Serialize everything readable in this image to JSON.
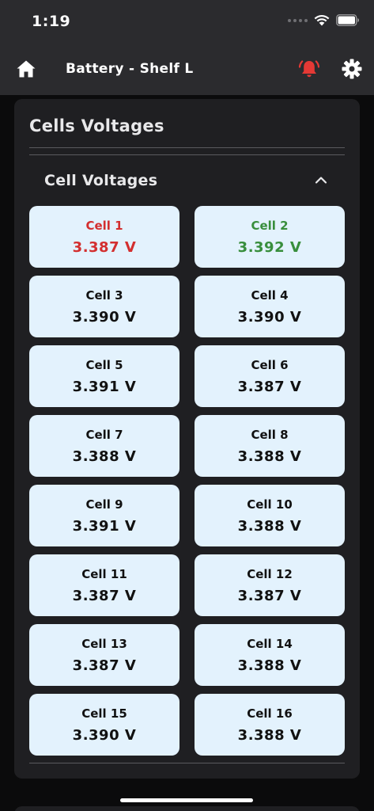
{
  "status_bar": {
    "time": "1:19"
  },
  "app_bar": {
    "title": "Battery - Shelf L",
    "icons": {
      "home": "home-icon",
      "alarm": "alarm-bell-icon",
      "settings": "gear-icon"
    },
    "alarm_color": "#e53935"
  },
  "card": {
    "title": "Cells Voltages",
    "section": {
      "title": "Cell Voltages",
      "expanded": true
    }
  },
  "colors": {
    "min_cell": "#d32f2f",
    "max_cell": "#388e3c",
    "normal": "#111111",
    "cell_bg": "#e3f2fd"
  },
  "cells": [
    {
      "name": "Cell 1",
      "value": "3.387 V",
      "status": "min"
    },
    {
      "name": "Cell 2",
      "value": "3.392 V",
      "status": "max"
    },
    {
      "name": "Cell 3",
      "value": "3.390 V",
      "status": "normal"
    },
    {
      "name": "Cell 4",
      "value": "3.390 V",
      "status": "normal"
    },
    {
      "name": "Cell 5",
      "value": "3.391 V",
      "status": "normal"
    },
    {
      "name": "Cell 6",
      "value": "3.387 V",
      "status": "normal"
    },
    {
      "name": "Cell 7",
      "value": "3.388 V",
      "status": "normal"
    },
    {
      "name": "Cell 8",
      "value": "3.388 V",
      "status": "normal"
    },
    {
      "name": "Cell 9",
      "value": "3.391 V",
      "status": "normal"
    },
    {
      "name": "Cell 10",
      "value": "3.388 V",
      "status": "normal"
    },
    {
      "name": "Cell 11",
      "value": "3.387 V",
      "status": "normal"
    },
    {
      "name": "Cell 12",
      "value": "3.387 V",
      "status": "normal"
    },
    {
      "name": "Cell 13",
      "value": "3.387 V",
      "status": "normal"
    },
    {
      "name": "Cell 14",
      "value": "3.388 V",
      "status": "normal"
    },
    {
      "name": "Cell 15",
      "value": "3.390 V",
      "status": "normal"
    },
    {
      "name": "Cell 16",
      "value": "3.388 V",
      "status": "normal"
    }
  ]
}
